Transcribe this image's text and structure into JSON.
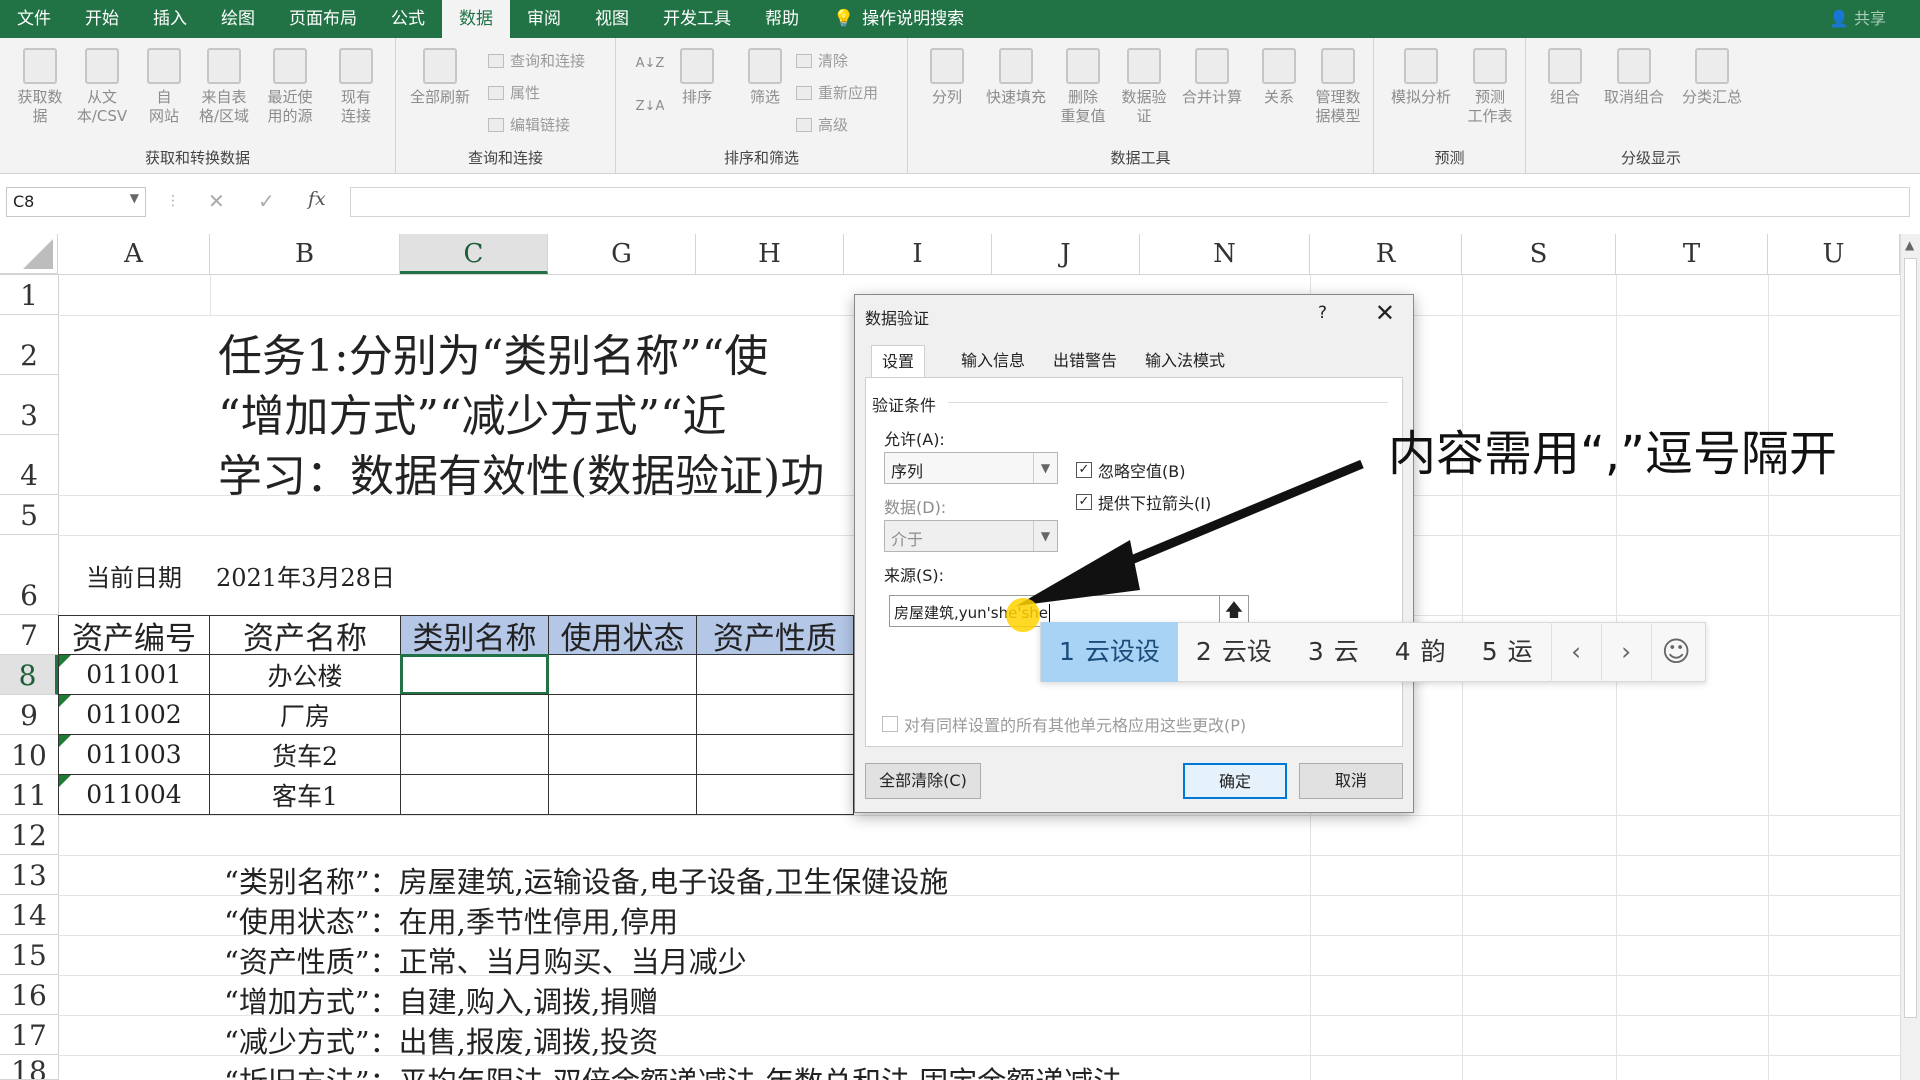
{
  "menubar": {
    "tabs": [
      "文件",
      "开始",
      "插入",
      "绘图",
      "页面布局",
      "公式",
      "数据",
      "审阅",
      "视图",
      "开发工具",
      "帮助"
    ],
    "active_index": 6,
    "help_search": "操作说明搜索",
    "share": "共享"
  },
  "ribbon": {
    "g1": {
      "name": "获取和转换数据",
      "b1": "获取数\n据",
      "b2": "从文\n本/CSV",
      "b3": "自\n网站",
      "b4": "来自表\n格/区域",
      "b5": "最近使\n用的源",
      "b6": "现有\n连接"
    },
    "g2": {
      "name": "查询和连接",
      "b1": "全部刷新",
      "s1": "查询和连接",
      "s2": "属性",
      "s3": "编辑链接"
    },
    "g3": {
      "name": "排序和筛选",
      "b1": "排序",
      "b2": "筛选",
      "s1": "清除",
      "s2": "重新应用",
      "s3": "高级"
    },
    "g4": {
      "name": "数据工具",
      "b1": "分列",
      "b2": "快速填充",
      "b3": "删除\n重复值",
      "b4": "数据验\n证",
      "b5": "合并计算",
      "b6": "关系",
      "b7": "管理数\n据模型"
    },
    "g5": {
      "name": "预测",
      "b1": "模拟分析",
      "b2": "预测\n工作表"
    },
    "g6": {
      "name": "分级显示",
      "b1": "组合",
      "b2": "取消组合",
      "b3": "分类汇总"
    }
  },
  "formula_bar": {
    "name_box": "C8",
    "cancel": "✕",
    "enter": "✓",
    "fx": "fx",
    "value": ""
  },
  "sheet": {
    "columns": [
      "A",
      "B",
      "C",
      "G",
      "H",
      "I",
      "J",
      "N",
      "R",
      "S",
      "T",
      "U"
    ],
    "rows": [
      "1",
      "2",
      "3",
      "4",
      "5",
      "6",
      "7",
      "8",
      "9",
      "10",
      "11",
      "12",
      "13",
      "14",
      "15",
      "16",
      "17",
      "18"
    ],
    "title_lines": [
      "任务1:分别为“类别名称”“使",
      "“增加方式”“减少方式”“近",
      "学习：数据有效性(数据验证)功"
    ],
    "date_label": "当前日期",
    "date_value": "2021年3月28日",
    "headers": [
      "资产编号",
      "资产名称",
      "类别名称",
      "使用状态",
      "资产性质"
    ],
    "records": [
      {
        "id": "011001",
        "name": "办公楼"
      },
      {
        "id": "011002",
        "name": "厂房"
      },
      {
        "id": "011003",
        "name": "货车2"
      },
      {
        "id": "011004",
        "name": "客车1"
      }
    ],
    "notes": [
      {
        "label": "“类别名称”：",
        "value": "房屋建筑,运输设备,电子设备,卫生保健设施"
      },
      {
        "label": "“使用状态”：",
        "value": "在用,季节性停用,停用"
      },
      {
        "label": "“资产性质”：",
        "value": "正常、当月购买、当月减少"
      },
      {
        "label": "“增加方式”：",
        "value": "自建,购入,调拨,捐赠"
      },
      {
        "label": "“减少方式”：",
        "value": "出售,报废,调拨,投资"
      },
      {
        "label": "“折旧方法”：",
        "value": "平均年限法,双倍余额递减法,年数总和法,固定余额递减法"
      }
    ]
  },
  "dialog": {
    "title": "数据验证",
    "help": "?",
    "close": "✕",
    "tabs": [
      "设置",
      "输入信息",
      "出错警告",
      "输入法模式"
    ],
    "section": "验证条件",
    "allow_label": "允许(A):",
    "allow_value": "序列",
    "data_label": "数据(D):",
    "data_value": "介于",
    "ignore_blank": "忽略空值(B)",
    "dropdown": "提供下拉箭头(I)",
    "source_label": "来源(S):",
    "source_value": "房屋建筑,yun'she'she",
    "apply_all": "对有同样设置的所有其他单元格应用这些更改(P)",
    "clear_all": "全部清除(C)",
    "ok": "确定",
    "cancel": "取消"
  },
  "ime": {
    "candidates": [
      {
        "n": "1",
        "t": "云设设"
      },
      {
        "n": "2",
        "t": "云设"
      },
      {
        "n": "3",
        "t": "云"
      },
      {
        "n": "4",
        "t": "韵"
      },
      {
        "n": "5",
        "t": "运"
      }
    ],
    "prev": "‹",
    "next": "›",
    "emoji": "☺"
  },
  "annotation": "内容需用“,”逗号隔开",
  "colors": {
    "excel_green": "#217346",
    "header_fill": "#b4c7e7",
    "ime_selected": "#a8d3f5"
  }
}
